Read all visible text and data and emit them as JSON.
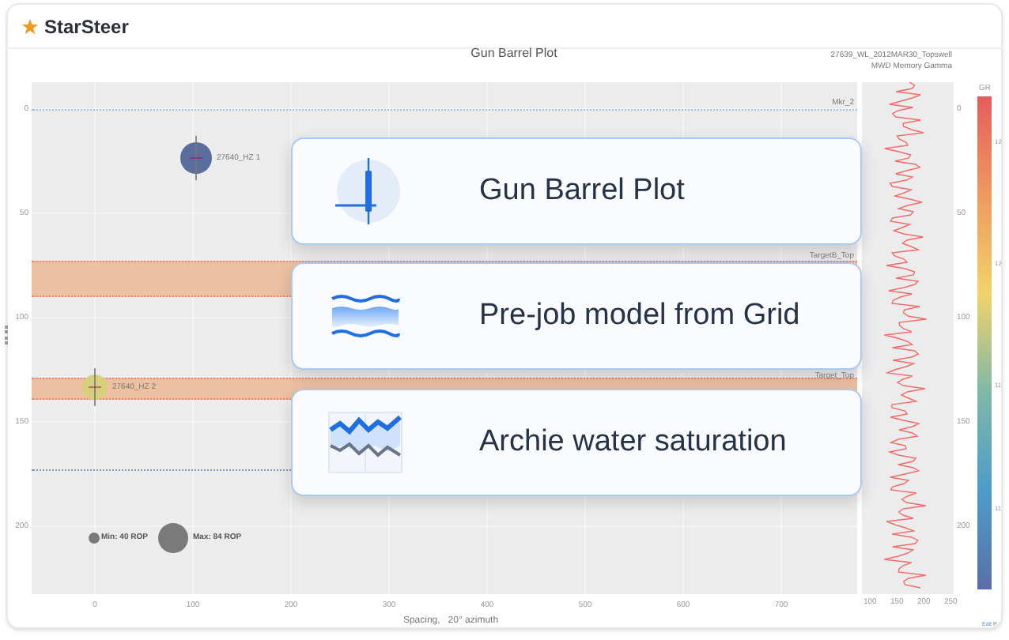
{
  "brand": {
    "name": "StarSteer"
  },
  "plot": {
    "title": "Gun Barrel Plot",
    "well_label": [
      "27639_WL_2012MAR30_Topswell",
      "MWD Memory Gamma"
    ],
    "y_ticks": [
      "0",
      "50",
      "100",
      "150",
      "200"
    ],
    "x_ticks": [
      "0",
      "100",
      "200",
      "300",
      "400",
      "500",
      "600",
      "700"
    ],
    "x_axis_title": "Spacing,   20° azimuth",
    "markers": [
      {
        "label": "Mkr_2",
        "kind": "line"
      },
      {
        "label": "TargetB_Top",
        "kind": "band"
      },
      {
        "label": "Target_Top",
        "kind": "band"
      }
    ],
    "wells": [
      {
        "label": "27640_HZ 1",
        "color": "#5a6e9c"
      },
      {
        "label": "27640_HZ 2",
        "color": "#d6d07a"
      }
    ],
    "legend": [
      "Min: 40 ROP",
      "Max: 84 ROP"
    ]
  },
  "log_track": {
    "depth_ticks": [
      "0",
      "50",
      "100",
      "150",
      "200"
    ],
    "x_ticks": [
      "100",
      "150",
      "200",
      "250"
    ]
  },
  "colorbar": {
    "title": "GR",
    "ticks": [
      "12",
      "12",
      "11",
      "11"
    ]
  },
  "features": [
    {
      "kind": "gun",
      "title": "Gun Barrel Plot"
    },
    {
      "kind": "grid",
      "title": "Pre-job model from Grid"
    },
    {
      "kind": "archie",
      "title": "Archie water saturation"
    }
  ],
  "edit_link": "Edit P"
}
